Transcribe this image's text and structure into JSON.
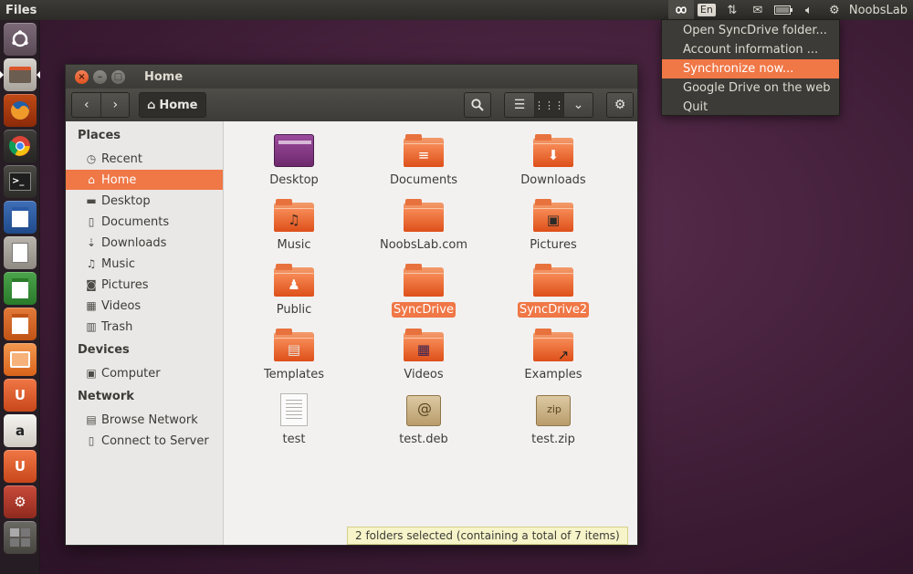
{
  "top_panel": {
    "app_title": "Files",
    "user_name": "NoobsLab",
    "indicators": [
      "syncdrive-icon",
      "keyboard-layout-icon",
      "network-icon",
      "mail-icon",
      "battery-icon",
      "sound-icon",
      "gear-icon"
    ],
    "keyboard_layout": "En"
  },
  "launcher": {
    "items": [
      "ubuntu-dash",
      "files",
      "firefox",
      "chromium",
      "terminal",
      "libreoffice-writer",
      "text-editor",
      "libreoffice-calc",
      "libreoffice-impress",
      "software-center",
      "ubuntu-one",
      "amazon",
      "ubuntu-one-music",
      "system-settings",
      "workspace-switcher"
    ],
    "amazon_glyph": "a",
    "ubuntuone_glyph": "U"
  },
  "window": {
    "title": "Home",
    "path_label": "Home",
    "sidebar": {
      "places_heading": "Places",
      "places": [
        {
          "label": "Recent",
          "icon": "clock-icon",
          "glyph": "◷"
        },
        {
          "label": "Home",
          "icon": "home-icon",
          "glyph": "⌂",
          "selected": true
        },
        {
          "label": "Desktop",
          "icon": "folder-icon",
          "glyph": "▬"
        },
        {
          "label": "Documents",
          "icon": "document-icon",
          "glyph": "▯"
        },
        {
          "label": "Downloads",
          "icon": "download-icon",
          "glyph": "⇣"
        },
        {
          "label": "Music",
          "icon": "music-icon",
          "glyph": "♫"
        },
        {
          "label": "Pictures",
          "icon": "camera-icon",
          "glyph": "◙"
        },
        {
          "label": "Videos",
          "icon": "film-icon",
          "glyph": "▦"
        },
        {
          "label": "Trash",
          "icon": "trash-icon",
          "glyph": "▥"
        }
      ],
      "devices_heading": "Devices",
      "devices": [
        {
          "label": "Computer",
          "icon": "computer-icon",
          "glyph": "▣"
        }
      ],
      "network_heading": "Network",
      "network": [
        {
          "label": "Browse Network",
          "icon": "network-icon",
          "glyph": "▤"
        },
        {
          "label": "Connect to Server",
          "icon": "server-icon",
          "glyph": "▯"
        }
      ]
    },
    "files": [
      {
        "name": "Desktop",
        "type": "desktop"
      },
      {
        "name": "Documents",
        "type": "folder",
        "emblem": "≡"
      },
      {
        "name": "Downloads",
        "type": "folder",
        "emblem": "⬇"
      },
      {
        "name": "Music",
        "type": "folder",
        "emblem": "♫"
      },
      {
        "name": "NoobsLab.com",
        "type": "folder",
        "emblem": ""
      },
      {
        "name": "Pictures",
        "type": "folder",
        "emblem": "▣"
      },
      {
        "name": "Public",
        "type": "folder",
        "emblem": "♟"
      },
      {
        "name": "SyncDrive",
        "type": "folder",
        "emblem": "",
        "selected": true
      },
      {
        "name": "SyncDrive2",
        "type": "folder",
        "emblem": "",
        "selected": true
      },
      {
        "name": "Templates",
        "type": "folder",
        "emblem": "▤"
      },
      {
        "name": "Videos",
        "type": "folder",
        "emblem": "▦"
      },
      {
        "name": "Examples",
        "type": "folder",
        "emblem": "↗"
      },
      {
        "name": "test",
        "type": "text"
      },
      {
        "name": "test.deb",
        "type": "deb",
        "badge": "@"
      },
      {
        "name": "test.zip",
        "type": "zip",
        "badge": "zip"
      }
    ],
    "status": "2 folders selected  (containing a total of 7 items)"
  },
  "menu": {
    "items": [
      {
        "label": "Open SyncDrive folder..."
      },
      {
        "label": "Account information ..."
      },
      {
        "label": "Synchronize now...",
        "highlighted": true
      },
      {
        "label": "Google Drive on the web"
      },
      {
        "label": "Quit"
      }
    ]
  },
  "colors": {
    "accent": "#f07746",
    "panel": "#3c3b37",
    "desktop": "#4a2442"
  }
}
